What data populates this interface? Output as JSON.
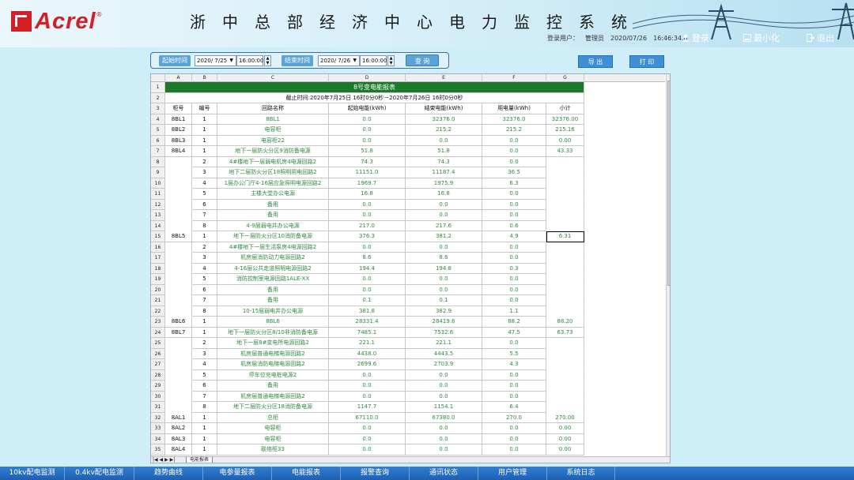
{
  "app": {
    "logo_text": "Acrel",
    "logo_reg": "®",
    "title": "浙中总部经济中心电力监控系统"
  },
  "header": {
    "user_label": "登录用户：",
    "user_name": "管理员",
    "date": "2020/07/26",
    "time": "16:46:34.0",
    "login": "登录",
    "minimize": "最小化",
    "exit": "退出"
  },
  "toolbar": {
    "start_label": "起始时间",
    "start_date": "2020/ 7/25",
    "start_time": "16:00:00",
    "end_label": "结束时间",
    "end_date": "2020/ 7/26",
    "end_time": "16:00:00",
    "query": "查 询",
    "export": "导 出",
    "print": "打 印"
  },
  "sheet": {
    "columns": [
      "",
      "A",
      "B",
      "C",
      "D",
      "E",
      "F",
      "G"
    ],
    "title": "8号变电能报表",
    "subtitle": "截止时间:2020年7月25日 16时0分0秒－2020年7月26日 16时0分0秒",
    "headers": [
      "柜号",
      "编号",
      "回路名称",
      "起始电能(kWh)",
      "结束电能(kWh)",
      "用电量(kWh)",
      "小计"
    ],
    "rows": [
      [
        "4",
        "8BL1",
        "1",
        "8BL1",
        "0.0",
        "32376.0",
        "32376.0",
        "32376.00"
      ],
      [
        "5",
        "8BL2",
        "1",
        "电容柜",
        "0.0",
        "215.2",
        "215.2",
        "215.16"
      ],
      [
        "6",
        "8BL3",
        "1",
        "电容柜22",
        "0.0",
        "0.0",
        "0.0",
        "0.00"
      ],
      [
        "7",
        "8BL4",
        "1",
        "地下一层防火分区9消防备电源",
        "51.8",
        "51.8",
        "0.0",
        "43.33"
      ],
      [
        "8",
        "",
        "2",
        "4#楼地下一层弱电机房4电源回路2",
        "74.3",
        "74.3",
        "0.0",
        ""
      ],
      [
        "9",
        "",
        "3",
        "地下二层防火分区18照明用电回路2",
        "11151.0",
        "11187.4",
        "36.5",
        ""
      ],
      [
        "10",
        "",
        "4",
        "1层办公门厅4-16层应急照明电源回路2",
        "1969.7",
        "1975.9",
        "6.3",
        ""
      ],
      [
        "11",
        "",
        "5",
        "主楼大堂办公电源",
        "16.8",
        "16.8",
        "0.0",
        ""
      ],
      [
        "12",
        "",
        "6",
        "备用",
        "0.0",
        "0.0",
        "0.0",
        ""
      ],
      [
        "13",
        "",
        "7",
        "备用",
        "0.0",
        "0.0",
        "0.0",
        ""
      ],
      [
        "14",
        "",
        "8",
        "4-9层弱电井办公电源",
        "217.0",
        "217.6",
        "0.6",
        ""
      ],
      [
        "15",
        "8BL5",
        "1",
        "地下一层防火分区10消防备电源",
        "376.3",
        "381.2",
        "4.9",
        "6.31"
      ],
      [
        "16",
        "",
        "2",
        "4#楼地下一层生活泵房4电源回路2",
        "0.0",
        "0.0",
        "0.0",
        ""
      ],
      [
        "17",
        "",
        "3",
        "机房层消防动力电源回路2",
        "8.6",
        "8.6",
        "0.0",
        ""
      ],
      [
        "18",
        "",
        "4",
        "4-16层公共走道照明电源回路2",
        "194.4",
        "194.8",
        "0.3",
        ""
      ],
      [
        "19",
        "",
        "5",
        "消防控制室电源回路1ALE-XX",
        "0.0",
        "0.0",
        "0.0",
        ""
      ],
      [
        "20",
        "",
        "6",
        "备用",
        "0.0",
        "0.0",
        "0.0",
        ""
      ],
      [
        "21",
        "",
        "7",
        "备用",
        "0.1",
        "0.1",
        "0.0",
        ""
      ],
      [
        "22",
        "",
        "8",
        "10-15层弱电井办公电源",
        "381.8",
        "382.9",
        "1.1",
        ""
      ],
      [
        "23",
        "8BL6",
        "1",
        "8BL6",
        "28331.4",
        "28419.6",
        "88.2",
        "88.20"
      ],
      [
        "24",
        "8BL7",
        "1",
        "地下一层防火分区8/10非消防备电源",
        "7485.1",
        "7532.6",
        "47.5",
        "63.73"
      ],
      [
        "25",
        "",
        "2",
        "地下一层8#变电所电源回路2",
        "221.1",
        "221.1",
        "0.0",
        ""
      ],
      [
        "26",
        "",
        "3",
        "机房层普通电梯电源回路2",
        "4438.0",
        "4443.5",
        "5.5",
        ""
      ],
      [
        "27",
        "",
        "4",
        "机房层消防电梯电源回路2",
        "2699.6",
        "2703.9",
        "4.3",
        ""
      ],
      [
        "28",
        "",
        "5",
        "停车位充电桩电源2",
        "0.0",
        "0.0",
        "0.0",
        ""
      ],
      [
        "29",
        "",
        "6",
        "备用",
        "0.0",
        "0.0",
        "0.0",
        ""
      ],
      [
        "30",
        "",
        "7",
        "机房层普通电梯电源回路2",
        "0.0",
        "0.0",
        "0.0",
        ""
      ],
      [
        "31",
        "",
        "8",
        "地下二层防火分区18消防备电源",
        "1147.7",
        "1154.1",
        "6.4",
        ""
      ],
      [
        "32",
        "8AL1",
        "1",
        "总柜",
        "67110.0",
        "67380.0",
        "270.0",
        "270.00"
      ],
      [
        "33",
        "8AL2",
        "1",
        "电容柜",
        "0.0",
        "0.0",
        "0.0",
        "0.00"
      ],
      [
        "34",
        "8AL3",
        "1",
        "电容柜",
        "0.0",
        "0.0",
        "0.0",
        "0.00"
      ],
      [
        "35",
        "8AL4",
        "1",
        "联络柜33",
        "0.0",
        "0.0",
        "0.0",
        "0.00"
      ]
    ],
    "tab_nav": "|◀ ◀ ▶ ▶|",
    "tab_name": "电能报表"
  },
  "nav": [
    "10kv配电监测",
    "0.4kv配电监测",
    "趋势曲线",
    "电参量报表",
    "电能报表",
    "报警查询",
    "通讯状态",
    "用户管理",
    "系统日志"
  ]
}
